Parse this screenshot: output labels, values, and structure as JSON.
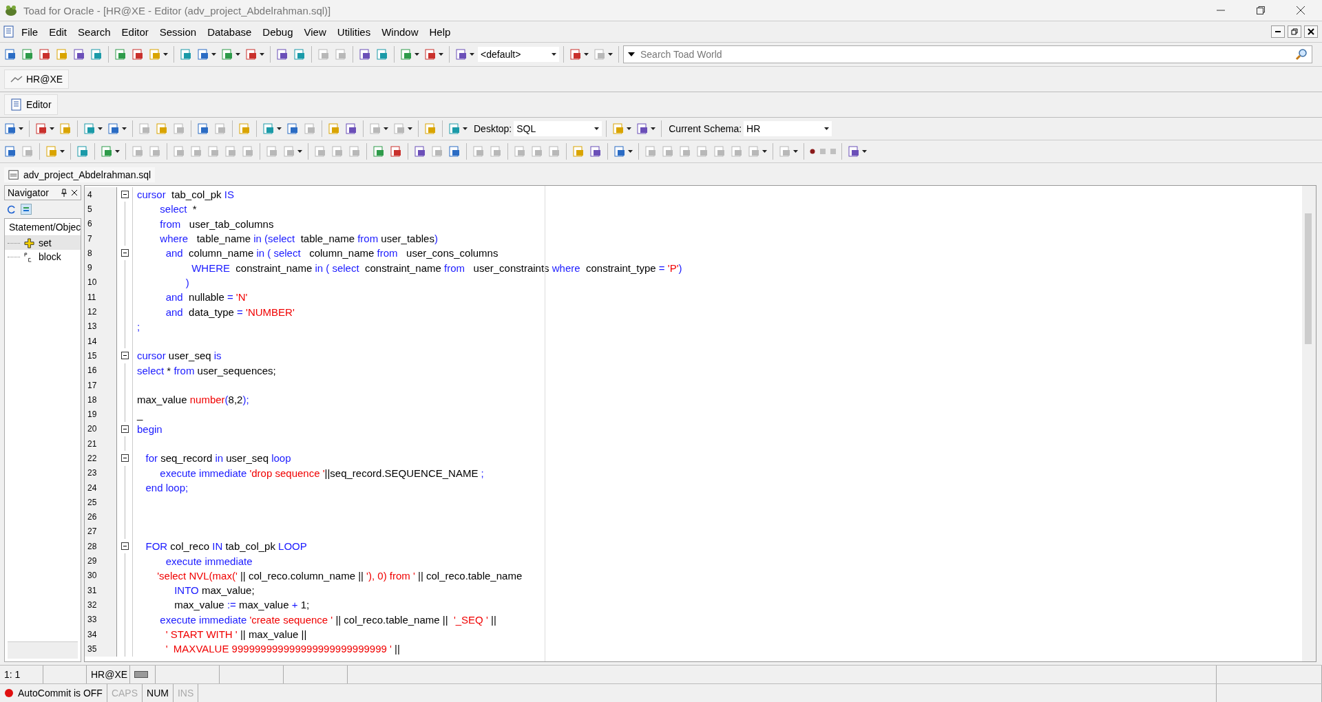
{
  "window": {
    "title": "Toad for Oracle - [HR@XE - Editor (adv_project_Abdelrahman.sql)]"
  },
  "menu": [
    "File",
    "Edit",
    "Search",
    "Editor",
    "Session",
    "Database",
    "Debug",
    "View",
    "Utilities",
    "Window",
    "Help"
  ],
  "main_toolbar": {
    "buttons": [
      {
        "kind": "button",
        "disabled": false,
        "dropdown": false
      },
      {
        "kind": "button",
        "disabled": false,
        "dropdown": false
      },
      {
        "kind": "button",
        "disabled": false,
        "dropdown": false
      },
      {
        "kind": "button",
        "disabled": false,
        "dropdown": false
      },
      {
        "kind": "button",
        "disabled": false,
        "dropdown": false
      },
      {
        "kind": "button",
        "disabled": false,
        "dropdown": false
      },
      {
        "kind": "sep"
      },
      {
        "kind": "button",
        "disabled": false,
        "dropdown": false
      },
      {
        "kind": "button",
        "disabled": false,
        "dropdown": false
      },
      {
        "kind": "button",
        "disabled": false,
        "dropdown": true
      },
      {
        "kind": "sep"
      },
      {
        "kind": "button",
        "disabled": false,
        "dropdown": false
      },
      {
        "kind": "button",
        "disabled": false,
        "dropdown": true
      },
      {
        "kind": "button",
        "disabled": false,
        "dropdown": true
      },
      {
        "kind": "button",
        "disabled": false,
        "dropdown": true
      },
      {
        "kind": "sep"
      },
      {
        "kind": "button",
        "disabled": false,
        "dropdown": false
      },
      {
        "kind": "button",
        "disabled": false,
        "dropdown": false
      },
      {
        "kind": "sep"
      },
      {
        "kind": "button",
        "disabled": true,
        "dropdown": false
      },
      {
        "kind": "button",
        "disabled": true,
        "dropdown": false
      },
      {
        "kind": "sep"
      },
      {
        "kind": "button",
        "disabled": false,
        "dropdown": false
      },
      {
        "kind": "button",
        "disabled": false,
        "dropdown": false
      },
      {
        "kind": "sep"
      },
      {
        "kind": "button",
        "disabled": false,
        "dropdown": true
      },
      {
        "kind": "button",
        "disabled": false,
        "dropdown": true
      },
      {
        "kind": "sep"
      },
      {
        "kind": "button",
        "disabled": false,
        "dropdown": true
      }
    ],
    "config_select": "<default>",
    "tail_buttons": [
      {
        "kind": "button",
        "disabled": false,
        "dropdown": true
      },
      {
        "kind": "button",
        "disabled": true,
        "dropdown": true
      }
    ],
    "search": {
      "placeholder": "Search Toad World"
    }
  },
  "connection_tab": {
    "label": "HR@XE"
  },
  "editor_tab": {
    "label": "Editor"
  },
  "editor_toolbar": {
    "buttons": [
      {
        "kind": "button",
        "disabled": false,
        "dropdown": true
      },
      {
        "kind": "sep"
      },
      {
        "kind": "button",
        "disabled": false,
        "dropdown": true
      },
      {
        "kind": "button",
        "disabled": false,
        "dropdown": false
      },
      {
        "kind": "sep"
      },
      {
        "kind": "button",
        "disabled": false,
        "dropdown": true
      },
      {
        "kind": "button",
        "disabled": false,
        "dropdown": true
      },
      {
        "kind": "sep"
      },
      {
        "kind": "button",
        "disabled": true,
        "dropdown": false
      },
      {
        "kind": "button",
        "disabled": false,
        "dropdown": false
      },
      {
        "kind": "button",
        "disabled": true,
        "dropdown": false
      },
      {
        "kind": "sep"
      },
      {
        "kind": "button",
        "disabled": false,
        "dropdown": false
      },
      {
        "kind": "button",
        "disabled": true,
        "dropdown": false
      },
      {
        "kind": "sep"
      },
      {
        "kind": "button",
        "disabled": false,
        "dropdown": false
      },
      {
        "kind": "sep"
      },
      {
        "kind": "button",
        "disabled": false,
        "dropdown": true
      },
      {
        "kind": "button",
        "disabled": false,
        "dropdown": false
      },
      {
        "kind": "button",
        "disabled": true,
        "dropdown": false
      },
      {
        "kind": "sep"
      },
      {
        "kind": "button",
        "disabled": false,
        "dropdown": false
      },
      {
        "kind": "button",
        "disabled": false,
        "dropdown": false
      },
      {
        "kind": "sep"
      },
      {
        "kind": "button",
        "disabled": true,
        "dropdown": true
      },
      {
        "kind": "button",
        "disabled": true,
        "dropdown": true
      },
      {
        "kind": "sep"
      },
      {
        "kind": "button",
        "disabled": false,
        "dropdown": false
      },
      {
        "kind": "sep"
      },
      {
        "kind": "button",
        "disabled": false,
        "dropdown": true
      }
    ],
    "desktop_label": "Desktop:",
    "desktop_value": "SQL",
    "mid_buttons": [
      {
        "kind": "button",
        "disabled": false,
        "dropdown": true
      },
      {
        "kind": "button",
        "disabled": false,
        "dropdown": true
      }
    ],
    "schema_label": "Current Schema:",
    "schema_value": "HR"
  },
  "action_toolbar": {
    "buttons": [
      {
        "kind": "button",
        "disabled": false,
        "dropdown": false
      },
      {
        "kind": "button",
        "disabled": true,
        "dropdown": false
      },
      {
        "kind": "sep"
      },
      {
        "kind": "button",
        "disabled": false,
        "dropdown": true
      },
      {
        "kind": "sep"
      },
      {
        "kind": "button",
        "disabled": false,
        "dropdown": false
      },
      {
        "kind": "sep"
      },
      {
        "kind": "button",
        "disabled": false,
        "dropdown": true
      },
      {
        "kind": "sep"
      },
      {
        "kind": "button",
        "disabled": true,
        "dropdown": false
      },
      {
        "kind": "button",
        "disabled": true,
        "dropdown": false
      },
      {
        "kind": "sep"
      },
      {
        "kind": "button",
        "disabled": true,
        "dropdown": false
      },
      {
        "kind": "button",
        "disabled": true,
        "dropdown": false
      },
      {
        "kind": "button",
        "disabled": true,
        "dropdown": false
      },
      {
        "kind": "button",
        "disabled": true,
        "dropdown": false
      },
      {
        "kind": "button",
        "disabled": true,
        "dropdown": false
      },
      {
        "kind": "sep"
      },
      {
        "kind": "button",
        "disabled": true,
        "dropdown": false
      },
      {
        "kind": "button",
        "disabled": true,
        "dropdown": true
      },
      {
        "kind": "sep"
      },
      {
        "kind": "button",
        "disabled": true,
        "dropdown": false
      },
      {
        "kind": "button",
        "disabled": true,
        "dropdown": false
      },
      {
        "kind": "button",
        "disabled": true,
        "dropdown": false
      },
      {
        "kind": "sep"
      },
      {
        "kind": "button",
        "disabled": false,
        "dropdown": false
      },
      {
        "kind": "button",
        "disabled": false,
        "dropdown": false
      },
      {
        "kind": "sep"
      },
      {
        "kind": "button",
        "disabled": false,
        "dropdown": false
      },
      {
        "kind": "button",
        "disabled": true,
        "dropdown": false
      },
      {
        "kind": "button",
        "disabled": false,
        "dropdown": false
      },
      {
        "kind": "sep"
      },
      {
        "kind": "button",
        "disabled": true,
        "dropdown": false
      },
      {
        "kind": "button",
        "disabled": true,
        "dropdown": false
      },
      {
        "kind": "sep"
      },
      {
        "kind": "button",
        "disabled": true,
        "dropdown": false
      },
      {
        "kind": "button",
        "disabled": true,
        "dropdown": false
      },
      {
        "kind": "button",
        "disabled": true,
        "dropdown": false
      },
      {
        "kind": "sep"
      },
      {
        "kind": "button",
        "disabled": false,
        "dropdown": false
      },
      {
        "kind": "button",
        "disabled": false,
        "dropdown": false
      },
      {
        "kind": "sep"
      },
      {
        "kind": "button",
        "disabled": false,
        "dropdown": true
      },
      {
        "kind": "sep"
      },
      {
        "kind": "button",
        "disabled": true,
        "dropdown": false
      },
      {
        "kind": "button",
        "disabled": true,
        "dropdown": false
      },
      {
        "kind": "button",
        "disabled": true,
        "dropdown": false
      },
      {
        "kind": "button",
        "disabled": true,
        "dropdown": false
      },
      {
        "kind": "button",
        "disabled": true,
        "dropdown": false
      },
      {
        "kind": "button",
        "disabled": true,
        "dropdown": false
      },
      {
        "kind": "button",
        "disabled": true,
        "dropdown": true
      },
      {
        "kind": "sep"
      },
      {
        "kind": "button",
        "disabled": true,
        "dropdown": true
      },
      {
        "kind": "sep"
      },
      {
        "kind": "record",
        "disabled": false
      },
      {
        "kind": "record",
        "disabled": true
      },
      {
        "kind": "record",
        "disabled": true
      },
      {
        "kind": "sep"
      },
      {
        "kind": "button",
        "disabled": false,
        "dropdown": true
      }
    ]
  },
  "file_tab": {
    "label": "adv_project_Abdelrahman.sql"
  },
  "navigator": {
    "title": "Navigator",
    "column": "Statement/Objec",
    "items": [
      {
        "label": "set",
        "selected": true
      },
      {
        "label": "block",
        "selected": false
      }
    ]
  },
  "editor": {
    "lines": [
      {
        "n": "4",
        "fold": true,
        "tokens": [
          {
            "kind": "keyword",
            "text": "cursor"
          },
          {
            "kind": "plain",
            "text": "  tab_col_pk "
          },
          {
            "kind": "keyword",
            "text": "IS"
          }
        ]
      },
      {
        "n": "5",
        "fold": false,
        "tokens": [
          {
            "kind": "keyword",
            "text": "        select"
          },
          {
            "kind": "plain",
            "text": "  *"
          }
        ]
      },
      {
        "n": "6",
        "fold": false,
        "tokens": [
          {
            "kind": "keyword",
            "text": "        from"
          },
          {
            "kind": "plain",
            "text": "   user_tab_columns"
          }
        ]
      },
      {
        "n": "7",
        "fold": false,
        "tokens": [
          {
            "kind": "keyword",
            "text": "        where"
          },
          {
            "kind": "plain",
            "text": "   table_name "
          },
          {
            "kind": "keyword",
            "text": "in (select"
          },
          {
            "kind": "plain",
            "text": "  table_name "
          },
          {
            "kind": "keyword",
            "text": "from"
          },
          {
            "kind": "plain",
            "text": " user_tables"
          },
          {
            "kind": "keyword",
            "text": ")"
          }
        ]
      },
      {
        "n": "8",
        "fold": true,
        "tokens": [
          {
            "kind": "keyword",
            "text": "          and"
          },
          {
            "kind": "plain",
            "text": "  column_name "
          },
          {
            "kind": "keyword",
            "text": "in ( select"
          },
          {
            "kind": "plain",
            "text": "   column_name "
          },
          {
            "kind": "keyword",
            "text": "from"
          },
          {
            "kind": "plain",
            "text": "   user_cons_columns"
          }
        ]
      },
      {
        "n": "9",
        "fold": false,
        "tokens": [
          {
            "kind": "keyword",
            "text": "                   WHERE"
          },
          {
            "kind": "plain",
            "text": "  constraint_name "
          },
          {
            "kind": "keyword",
            "text": "in ( select"
          },
          {
            "kind": "plain",
            "text": "  constraint_name "
          },
          {
            "kind": "keyword",
            "text": "from"
          },
          {
            "kind": "plain",
            "text": "   user_constraints "
          },
          {
            "kind": "keyword",
            "text": "where"
          },
          {
            "kind": "plain",
            "text": "  constraint_type "
          },
          {
            "kind": "keyword",
            "text": "= "
          },
          {
            "kind": "string",
            "text": "'P'"
          },
          {
            "kind": "keyword",
            "text": ")"
          }
        ]
      },
      {
        "n": "10",
        "fold": false,
        "tokens": [
          {
            "kind": "keyword",
            "text": "                 )"
          }
        ]
      },
      {
        "n": "11",
        "fold": false,
        "tokens": [
          {
            "kind": "keyword",
            "text": "          and"
          },
          {
            "kind": "plain",
            "text": "  nullable "
          },
          {
            "kind": "keyword",
            "text": "= "
          },
          {
            "kind": "string",
            "text": "'N'"
          }
        ]
      },
      {
        "n": "12",
        "fold": false,
        "tokens": [
          {
            "kind": "keyword",
            "text": "          and"
          },
          {
            "kind": "plain",
            "text": "  data_type "
          },
          {
            "kind": "keyword",
            "text": "= "
          },
          {
            "kind": "string",
            "text": "'NUMBER'"
          }
        ]
      },
      {
        "n": "13",
        "fold": false,
        "tokens": [
          {
            "kind": "keyword",
            "text": ";"
          }
        ]
      },
      {
        "n": "14",
        "fold": false
      },
      {
        "n": "15",
        "fold": true,
        "tokens": [
          {
            "kind": "keyword",
            "text": "cursor"
          },
          {
            "kind": "plain",
            "text": " user_seq "
          },
          {
            "kind": "keyword",
            "text": "is"
          }
        ]
      },
      {
        "n": "16",
        "fold": false,
        "tokens": [
          {
            "kind": "keyword",
            "text": "select"
          },
          {
            "kind": "plain",
            "text": " * "
          },
          {
            "kind": "keyword",
            "text": "from"
          },
          {
            "kind": "plain",
            "text": " user_sequences;"
          }
        ]
      },
      {
        "n": "17",
        "fold": false
      },
      {
        "n": "18",
        "fold": false,
        "tokens": [
          {
            "kind": "plain",
            "text": "max_value "
          },
          {
            "kind": "string",
            "text": "number"
          },
          {
            "kind": "keyword",
            "text": "("
          },
          {
            "kind": "plain",
            "text": "8,2"
          },
          {
            "kind": "keyword",
            "text": ");"
          }
        ]
      },
      {
        "n": "19",
        "fold": false,
        "tokens": [
          {
            "kind": "plain",
            "text": "_"
          }
        ]
      },
      {
        "n": "20",
        "fold": true,
        "tokens": [
          {
            "kind": "keyword",
            "text": "begin"
          }
        ]
      },
      {
        "n": "21",
        "fold": false
      },
      {
        "n": "22",
        "fold": true,
        "tokens": [
          {
            "kind": "keyword",
            "text": "   for"
          },
          {
            "kind": "plain",
            "text": " seq_record "
          },
          {
            "kind": "keyword",
            "text": "in"
          },
          {
            "kind": "plain",
            "text": " user_seq "
          },
          {
            "kind": "keyword",
            "text": "loop"
          }
        ]
      },
      {
        "n": "23",
        "fold": false,
        "tokens": [
          {
            "kind": "keyword",
            "text": "        execute immediate "
          },
          {
            "kind": "string",
            "text": "'drop sequence '"
          },
          {
            "kind": "plain",
            "text": "||seq_record.SEQUENCE_NAME "
          },
          {
            "kind": "keyword",
            "text": ";"
          }
        ]
      },
      {
        "n": "24",
        "fold": false,
        "tokens": [
          {
            "kind": "keyword",
            "text": "   end loop;"
          }
        ]
      },
      {
        "n": "25",
        "fold": false
      },
      {
        "n": "26",
        "fold": false
      },
      {
        "n": "27",
        "fold": false
      },
      {
        "n": "28",
        "fold": true,
        "tokens": [
          {
            "kind": "keyword",
            "text": "   FOR"
          },
          {
            "kind": "plain",
            "text": " col_reco "
          },
          {
            "kind": "keyword",
            "text": "IN"
          },
          {
            "kind": "plain",
            "text": " tab_col_pk "
          },
          {
            "kind": "keyword",
            "text": "LOOP"
          }
        ]
      },
      {
        "n": "29",
        "fold": false,
        "tokens": [
          {
            "kind": "keyword",
            "text": "          execute immediate"
          }
        ]
      },
      {
        "n": "30",
        "fold": false,
        "tokens": [
          {
            "kind": "string",
            "text": "       'select NVL(max('"
          },
          {
            "kind": "plain",
            "text": " || col_reco.column_name || "
          },
          {
            "kind": "string",
            "text": "'), 0) from '"
          },
          {
            "kind": "plain",
            "text": " || col_reco.table_name"
          }
        ]
      },
      {
        "n": "31",
        "fold": false,
        "tokens": [
          {
            "kind": "keyword",
            "text": "             INTO"
          },
          {
            "kind": "plain",
            "text": " max_value;"
          }
        ]
      },
      {
        "n": "32",
        "fold": false,
        "tokens": [
          {
            "kind": "plain",
            "text": "             max_value "
          },
          {
            "kind": "keyword",
            "text": ":="
          },
          {
            "kind": "plain",
            "text": " max_value "
          },
          {
            "kind": "keyword",
            "text": "+"
          },
          {
            "kind": "plain",
            "text": " 1;"
          }
        ]
      },
      {
        "n": "33",
        "fold": false,
        "tokens": [
          {
            "kind": "keyword",
            "text": "        execute immediate "
          },
          {
            "kind": "string",
            "text": "'create sequence '"
          },
          {
            "kind": "plain",
            "text": " || col_reco.table_name ||  "
          },
          {
            "kind": "string",
            "text": "'_SEQ '"
          },
          {
            "kind": "plain",
            "text": " ||"
          }
        ]
      },
      {
        "n": "34",
        "fold": false,
        "tokens": [
          {
            "kind": "string",
            "text": "          ' START WITH '"
          },
          {
            "kind": "plain",
            "text": " || max_value ||"
          }
        ]
      },
      {
        "n": "35",
        "fold": false,
        "tokens": [
          {
            "kind": "string",
            "text": "          '  MAXVALUE 999999999999999999999999999 '"
          },
          {
            "kind": "plain",
            "text": " ||"
          }
        ]
      }
    ]
  },
  "status_bar": {
    "position": "1:  1",
    "connection": "HR@XE",
    "autocommit": "AutoCommit is OFF",
    "keys": [
      {
        "label": "CAPS",
        "on": false
      },
      {
        "label": "NUM",
        "on": true
      },
      {
        "label": "INS",
        "on": false
      }
    ]
  }
}
